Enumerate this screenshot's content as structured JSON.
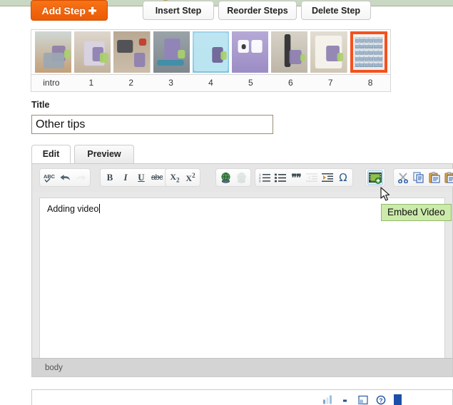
{
  "window": {
    "top_bar_color": "#c9d8c2"
  },
  "step_actions": {
    "add_step": "Add Step",
    "add_step_icon": "plus-icon",
    "insert_step": "Insert Step",
    "reorder_steps": "Reorder Steps",
    "delete_step": "Delete Step",
    "accent_color": "#f4511e"
  },
  "step_strip": {
    "labels": [
      "intro",
      "1",
      "2",
      "3",
      "4",
      "5",
      "6",
      "7",
      "8"
    ],
    "selected_index": 8,
    "selection_color": "#f4511e",
    "thumbnails": [
      {
        "alt": "camera with crochet owl cozy on wooden table"
      },
      {
        "alt": "crochet owl pouch with cable"
      },
      {
        "alt": "tools and parts on a table"
      },
      {
        "alt": "crochet owl cozy held in hand"
      },
      {
        "alt": "blue polka dot fabric with owl"
      },
      {
        "alt": "close up of crochet owl face"
      },
      {
        "alt": "owl mounted on a tripod clamp"
      },
      {
        "alt": "owl on a flexible stand on paper"
      },
      {
        "alt": "grid sheet of many small photos"
      }
    ]
  },
  "title_field": {
    "label": "Title",
    "value": "Other tips",
    "placeholder": ""
  },
  "editor_tabs": [
    {
      "label": "Edit",
      "active": true
    },
    {
      "label": "Preview",
      "active": false
    }
  ],
  "toolbar": {
    "groups": [
      {
        "name": "history",
        "buttons": [
          {
            "name": "spellcheck-icon",
            "glyph": "ABC",
            "state": "enabled",
            "type": "abc"
          },
          {
            "name": "undo-icon",
            "glyph": "↶",
            "state": "enabled",
            "type": "undo"
          },
          {
            "name": "redo-icon",
            "glyph": "↷",
            "state": "disabled",
            "type": "redo"
          }
        ]
      },
      {
        "name": "text-format",
        "buttons": [
          {
            "name": "bold-icon",
            "glyph": "B",
            "state": "enabled",
            "type": "bold"
          },
          {
            "name": "italic-icon",
            "glyph": "I",
            "state": "enabled",
            "type": "italic"
          },
          {
            "name": "underline-icon",
            "glyph": "U",
            "state": "enabled",
            "type": "underline"
          },
          {
            "name": "strikethrough-icon",
            "glyph": "abc",
            "state": "enabled",
            "type": "strike"
          }
        ]
      },
      {
        "name": "script",
        "buttons": [
          {
            "name": "subscript-icon",
            "glyph": "X2",
            "state": "enabled",
            "type": "sub"
          },
          {
            "name": "superscript-icon",
            "glyph": "X2",
            "state": "enabled",
            "type": "sup"
          }
        ]
      },
      {
        "name": "link",
        "buttons": [
          {
            "name": "insert-link-icon",
            "glyph": "globe",
            "state": "enabled",
            "type": "link"
          },
          {
            "name": "unlink-icon",
            "glyph": "globe",
            "state": "disabled",
            "type": "unlink"
          }
        ]
      },
      {
        "name": "lists",
        "buttons": [
          {
            "name": "numbered-list-icon",
            "glyph": "123",
            "state": "enabled",
            "type": "ol"
          },
          {
            "name": "bulleted-list-icon",
            "glyph": "bullets",
            "state": "enabled",
            "type": "ul"
          },
          {
            "name": "blockquote-icon",
            "glyph": "”",
            "state": "enabled",
            "type": "quote"
          },
          {
            "name": "decrease-indent-icon",
            "glyph": "outdent",
            "state": "disabled",
            "type": "outdent"
          },
          {
            "name": "increase-indent-icon",
            "glyph": "indent",
            "state": "enabled",
            "type": "indent"
          },
          {
            "name": "special-character-icon",
            "glyph": "Ω",
            "state": "enabled",
            "type": "omega"
          }
        ]
      },
      {
        "name": "media",
        "buttons": [
          {
            "name": "embed-video-icon",
            "glyph": "film",
            "state": "hovered",
            "type": "video"
          }
        ]
      },
      {
        "name": "clipboard",
        "buttons": [
          {
            "name": "cut-icon",
            "glyph": "scissors",
            "state": "enabled",
            "type": "cut"
          },
          {
            "name": "copy-icon",
            "glyph": "copy",
            "state": "enabled",
            "type": "copy"
          },
          {
            "name": "paste-icon",
            "glyph": "paste",
            "state": "enabled",
            "type": "paste"
          },
          {
            "name": "paste-text-icon",
            "glyph": "paste",
            "state": "enabled",
            "type": "paste2"
          }
        ]
      }
    ]
  },
  "tooltip": {
    "text": "Embed Video",
    "background": "#cceaaa",
    "border": "#93ba6b"
  },
  "editor_body": {
    "content": "Adding video",
    "status_path": "body"
  },
  "bottom_bar": {
    "icons": [
      "chart-icon",
      "dot-icon",
      "window-icon",
      "help-icon"
    ],
    "block_color": "#1c4fa8"
  }
}
